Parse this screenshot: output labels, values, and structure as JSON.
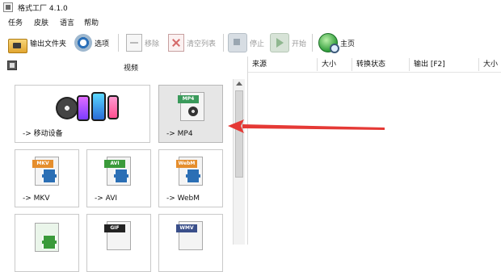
{
  "window": {
    "title": "格式工厂 4.1.0"
  },
  "menu": {
    "items": [
      "任务",
      "皮肤",
      "语言",
      "帮助"
    ]
  },
  "toolbar": {
    "output_folder": "输出文件夹",
    "options": "选项",
    "remove": "移除",
    "clear_list": "清空列表",
    "stop": "停止",
    "start": "开始",
    "home": "主页"
  },
  "left_panel": {
    "category": "视频",
    "tiles": [
      {
        "label": "-> 移动设备",
        "icon": "mobile-devices-icon",
        "selected": false
      },
      {
        "label": "-> MP4",
        "badge": "MP4",
        "icon": "mp4-file-icon",
        "selected": true
      },
      {
        "label": "-> MKV",
        "badge": "MKV",
        "icon": "mkv-file-icon",
        "selected": false
      },
      {
        "label": "-> AVI",
        "badge": "AVI",
        "icon": "avi-file-icon",
        "selected": false
      },
      {
        "label": "-> WebM",
        "badge": "WebM",
        "icon": "webm-file-icon",
        "selected": false
      },
      {
        "label": "",
        "icon": "video-file-icon",
        "selected": false
      },
      {
        "label": "",
        "badge": "GIF",
        "icon": "gif-file-icon",
        "selected": false
      },
      {
        "label": "",
        "badge": "WMV",
        "icon": "wmv-file-icon",
        "selected": false
      }
    ]
  },
  "task_list": {
    "columns": [
      "来源",
      "大小",
      "转换状态",
      "输出 [F2]",
      "大小"
    ]
  },
  "colors": {
    "annotation_arrow": "#e53935",
    "mp4_band": "#3a9a5b",
    "mkv_band": "#e58e2d",
    "avi_band": "#3a9a3a",
    "webm_band": "#e58e2d",
    "gif_band": "#222222",
    "wmv_band": "#3a4f8a"
  }
}
